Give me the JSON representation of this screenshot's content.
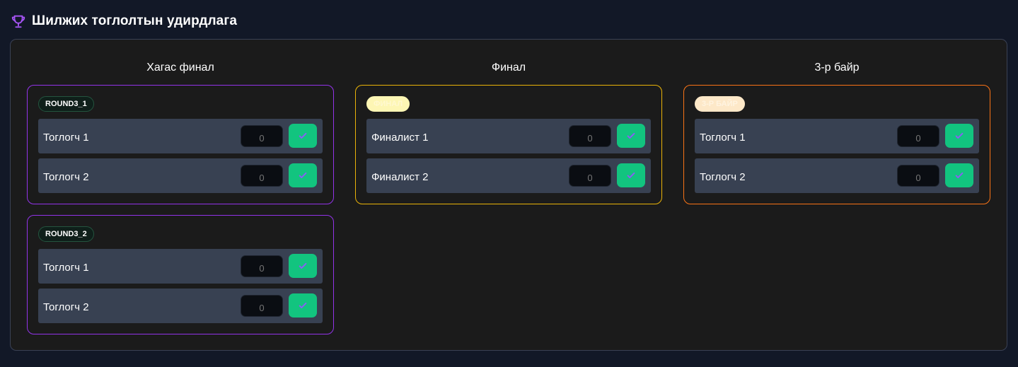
{
  "header": {
    "title": "Шилжих тоглолтын удирдлага",
    "icon": "trophy-icon",
    "icon_color": "#a855f7"
  },
  "columns": [
    {
      "title": "Хагас финал",
      "accent": "#9333ea",
      "matches": [
        {
          "badge": "ROUND3_1",
          "players": [
            {
              "name": "Тоглогч 1",
              "score_placeholder": "0"
            },
            {
              "name": "Тоглогч 2",
              "score_placeholder": "0"
            }
          ]
        },
        {
          "badge": "ROUND3_2",
          "players": [
            {
              "name": "Тоглогч 1",
              "score_placeholder": "0"
            },
            {
              "name": "Тоглогч 2",
              "score_placeholder": "0"
            }
          ]
        }
      ]
    },
    {
      "title": "Финал",
      "accent": "#eab308",
      "matches": [
        {
          "badge": "ФИНАЛ",
          "players": [
            {
              "name": "Финалист 1",
              "score_placeholder": "0"
            },
            {
              "name": "Финалист 2",
              "score_placeholder": "0"
            }
          ]
        }
      ]
    },
    {
      "title": "3-р байр",
      "accent": "#f97316",
      "matches": [
        {
          "badge": "3-Р БАЙР",
          "players": [
            {
              "name": "Тоглогч 1",
              "score_placeholder": "0"
            },
            {
              "name": "Тоглогч 2",
              "score_placeholder": "0"
            }
          ]
        }
      ]
    }
  ],
  "colors": {
    "confirm_button": "#12c47f",
    "check_icon": "#8b5cf6",
    "row_background": "#384152",
    "panel_background": "#1b1b1b",
    "page_background": "#121827"
  },
  "icons": {
    "confirm": "check-icon"
  }
}
